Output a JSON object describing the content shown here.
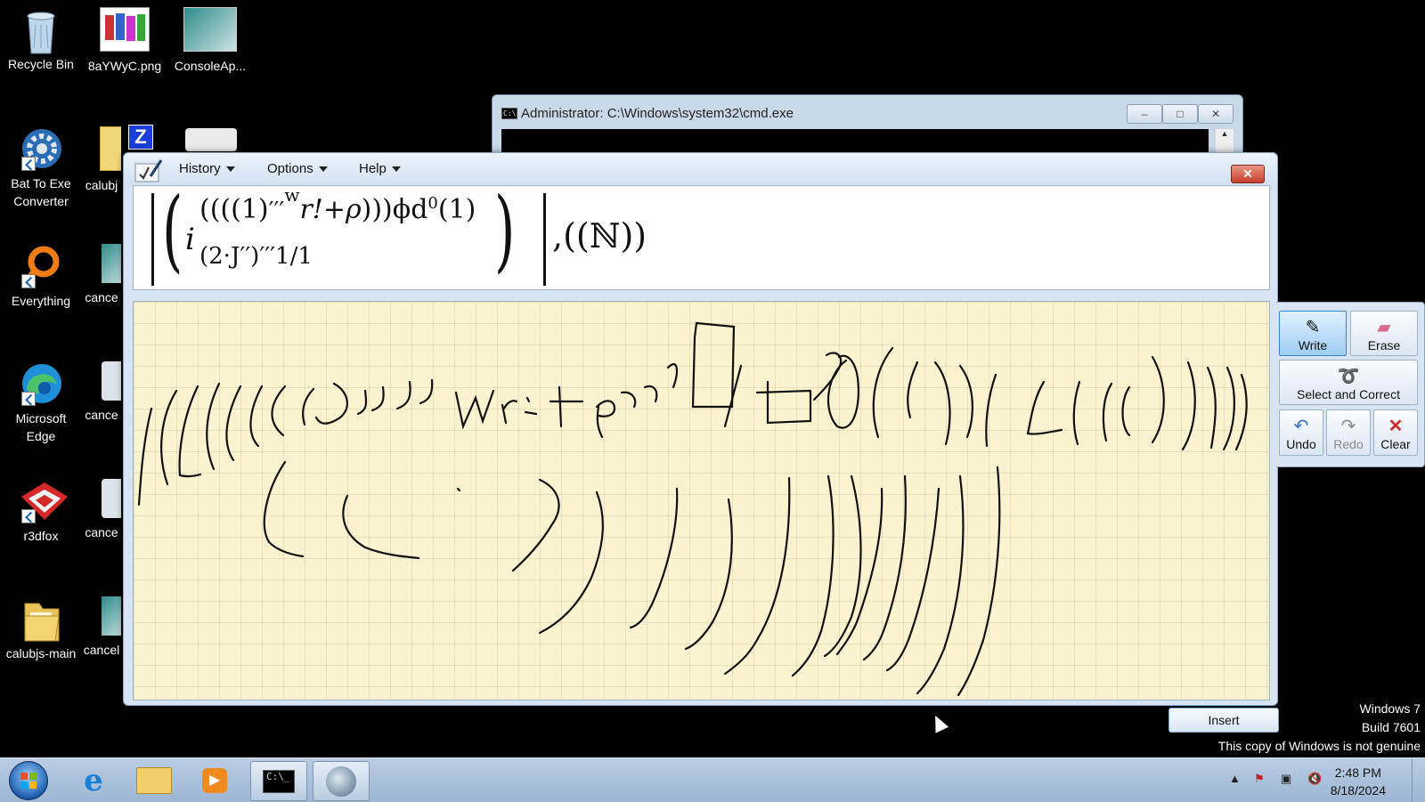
{
  "desktop": {
    "icons": [
      {
        "label": "Recycle Bin",
        "icon": "recycle-bin-icon"
      },
      {
        "label": "8aYWyC.png",
        "icon": "image-file-icon"
      },
      {
        "label": "ConsoleAp...",
        "icon": "image-file-icon"
      },
      {
        "label": "Bat To Exe\nConverter",
        "icon": "gear-icon"
      },
      {
        "label": "calubj",
        "icon": "folder-icon"
      },
      {
        "label": "Everything",
        "icon": "search-icon"
      },
      {
        "label": "cance",
        "icon": "image-file-icon"
      },
      {
        "label": "Microsoft\nEdge",
        "icon": "edge-icon"
      },
      {
        "label": "cance",
        "icon": "gear-icon"
      },
      {
        "label": "r3dfox",
        "icon": "r3dfox-icon"
      },
      {
        "label": "cance",
        "icon": "gear-icon"
      },
      {
        "label": "calubjs-main",
        "icon": "folder-icon"
      },
      {
        "label": "cancel",
        "icon": "image-file-icon"
      }
    ]
  },
  "cmd_window": {
    "title": "Administrator: C:\\Windows\\system32\\cmd.exe",
    "minimize": "–",
    "maximize": "□",
    "close": "✕"
  },
  "math_input_panel": {
    "menus": [
      "History",
      "Options",
      "Help"
    ],
    "close": "✕",
    "preview": {
      "exp1": "(1)",
      "primes": "′′′",
      "w": "w",
      "r_rho": "r!+ρ",
      "tail": "ϕd",
      "zero": "0",
      "one": "(1)",
      "i": "i",
      "sub": "(2·J′′)′′′1/1",
      "comma_N": ",((ℕ))"
    },
    "tools": {
      "write": "Write",
      "erase": "Erase",
      "select_correct": "Select and Correct",
      "undo": "Undo",
      "redo": "Redo",
      "clear": "Clear"
    },
    "insert": "Insert"
  },
  "watermark": {
    "line1": "Windows 7",
    "line2": "Build 7601",
    "line3": "This copy of Windows is not genuine"
  },
  "taskbar": {
    "time": "2:48 PM",
    "date": "8/18/2024",
    "apps": [
      "internet-explorer-icon",
      "file-explorer-icon",
      "media-player-icon",
      "cmd-icon",
      "math-input-panel-icon"
    ]
  }
}
